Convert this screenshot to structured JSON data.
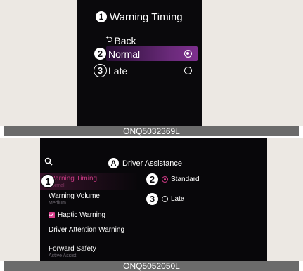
{
  "top_screen": {
    "title_badge": "1",
    "title": "Warning Timing",
    "back_label": "Back",
    "back_icon": "back-arrow-icon",
    "options": [
      {
        "badge": "2",
        "label": "Normal",
        "selected": true
      },
      {
        "badge": "3",
        "label": "Late",
        "selected": false
      }
    ],
    "highlight_color": "#7d2f8e"
  },
  "top_caption": "ONQ5032369L",
  "bottom_screen": {
    "search_icon": "search-icon",
    "header_badge": "A",
    "header_title": "Driver Assistance",
    "menu": [
      {
        "badge": "1",
        "label": "Warning Timing",
        "sub": "Normal",
        "active": true
      },
      {
        "label": "Warning Volume",
        "sub": "Medium"
      },
      {
        "label": "Haptic Warning",
        "checked": true
      },
      {
        "label": "Driver Attention Warning"
      },
      {
        "label": "Forward Safety",
        "sub": "Active Assist"
      }
    ],
    "options": [
      {
        "badge": "2",
        "label": "Standard",
        "selected": true
      },
      {
        "badge": "3",
        "label": "Late",
        "selected": false
      }
    ],
    "accent_color": "#d63c8a"
  },
  "bottom_caption": "ONQ5052050L"
}
